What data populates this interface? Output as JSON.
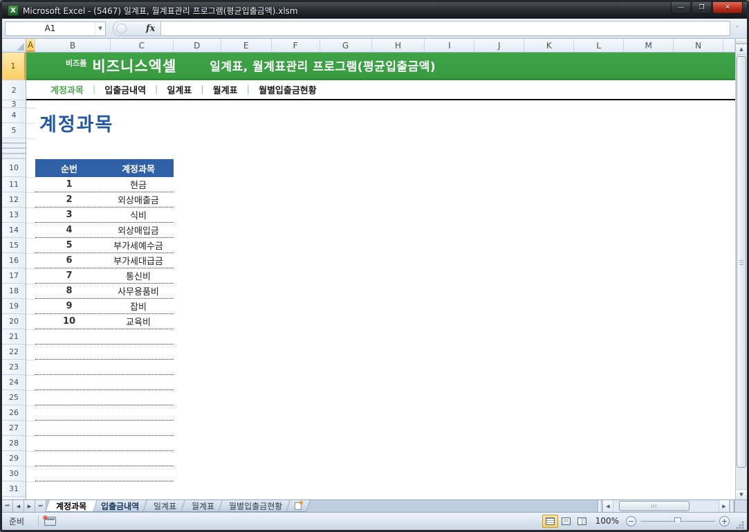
{
  "window": {
    "title": "Microsoft Excel - (5467) 일계표, 월계표관리 프로그램(평균입출금액).xlsm",
    "app_icon_glyph": "X",
    "controls": {
      "minimize": "—",
      "restore": "❐",
      "close": "✕"
    }
  },
  "formula_bar": {
    "cell_reference": "A1",
    "function_label": "fx",
    "formula_value": ""
  },
  "grid": {
    "column_headers": [
      "A",
      "B",
      "C",
      "D",
      "E",
      "F",
      "G",
      "H",
      "I",
      "J",
      "K",
      "L",
      "M",
      "N"
    ],
    "row_headers": [
      "1",
      "2",
      "3",
      "4",
      "5",
      "10",
      "11",
      "12",
      "13",
      "14",
      "15",
      "16",
      "17",
      "18",
      "19",
      "20",
      "21",
      "22",
      "23",
      "24",
      "25",
      "26",
      "27",
      "28",
      "29",
      "30",
      "31"
    ],
    "selected_column": "A",
    "selected_row": "1"
  },
  "banner": {
    "brand_small": "비즈폼",
    "brand_large": "비즈니스엑셀",
    "program_title": "일계표, 월계표관리 프로그램(평균입출금액)"
  },
  "nav": {
    "items": [
      "계정과목",
      "입출금내역",
      "일계표",
      "월계표",
      "월별입출금현황"
    ],
    "active_index": 0,
    "separator": "|"
  },
  "content": {
    "heading": "계정과목"
  },
  "table": {
    "column_headers": [
      "순번",
      "계정과목"
    ],
    "rows": [
      [
        "1",
        "현금"
      ],
      [
        "2",
        "외상매출금"
      ],
      [
        "3",
        "식비"
      ],
      [
        "4",
        "외상매입금"
      ],
      [
        "5",
        "부가세예수금"
      ],
      [
        "6",
        "부가세대급금"
      ],
      [
        "7",
        "통신비"
      ],
      [
        "8",
        "사무용품비"
      ],
      [
        "9",
        "잡비"
      ],
      [
        "10",
        "교육비"
      ]
    ],
    "empty_rows": 10
  },
  "sheet_tabs": {
    "tabs": [
      "계정과목",
      "입출금내역",
      "일계표",
      "월계표",
      "월별입출금현황"
    ],
    "active_index": 0
  },
  "status_bar": {
    "mode_label": "준비",
    "zoom_level": "100%"
  },
  "icons": {
    "up_arrow": "▲",
    "down_arrow": "▼",
    "left_arrow": "◀",
    "right_arrow": "▶",
    "first_tab": "⏮",
    "prev_tab": "◀",
    "next_tab": "▶",
    "last_tab": "⏭",
    "dropdown": "▼",
    "expand": "˅"
  },
  "colors": {
    "banner_green": "#3ea346",
    "banner_green_dark": "#2e8a37",
    "nav_active": "#4fa74f",
    "heading_blue": "#2257a5",
    "table_header_blue": "#2f5fa7",
    "selection_orange": "#f9ce63"
  }
}
